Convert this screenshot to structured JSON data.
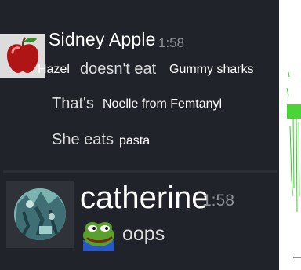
{
  "messages": [
    {
      "author": "Sidney Apple",
      "timestamp": "1:58",
      "avatar": "red-apple",
      "lines": [
        [
          "Hazel",
          "doesn't eat",
          "Gummy sharks"
        ],
        [
          "That's",
          "Noelle from Femtanyl"
        ],
        [
          "She eats",
          "pasta"
        ]
      ]
    },
    {
      "author": "catherine",
      "timestamp": "1:58",
      "avatar": "teal-photo",
      "emoji": "pepe-frog",
      "text": "oops"
    }
  ],
  "colors": {
    "background": "#202329",
    "username": "#ffffff",
    "timestamp": "#8e9297",
    "message_text": "#dcddde",
    "side_panel": "#ffffff",
    "side_graphic": "#35d020"
  }
}
